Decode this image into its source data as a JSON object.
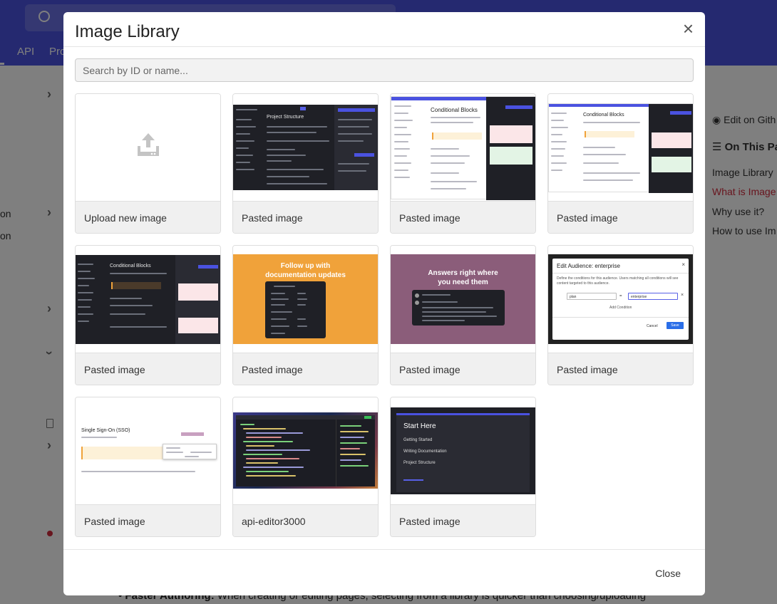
{
  "background": {
    "nav": [
      "API",
      "Pro"
    ],
    "sidebar_fragments": [
      "on",
      "on"
    ],
    "right_panel": {
      "edit_link": "Edit on Gith",
      "on_this_page": "On This Pag",
      "toc": [
        "Image Library",
        "What is Image",
        "Why use it?",
        "How to use Im"
      ]
    },
    "bottom_text_bold": "Faster Authoring:",
    "bottom_text": " When creating or editing pages, selecting from a library is quicker than choosing/uploading"
  },
  "modal": {
    "title": "Image Library",
    "close_icon": "×",
    "search_placeholder": "Search by ID or name...",
    "search_value": "",
    "cards": [
      {
        "label": "Upload new image",
        "thumb": "upload"
      },
      {
        "label": "Pasted image",
        "thumb": "dark-doc"
      },
      {
        "label": "Pasted image",
        "thumb": "light-doc"
      },
      {
        "label": "Pasted image",
        "thumb": "light-doc-2"
      },
      {
        "label": "Pasted image",
        "thumb": "dark-doc-2"
      },
      {
        "label": "Pasted image",
        "thumb": "orange-promo"
      },
      {
        "label": "Pasted image",
        "thumb": "purple-promo"
      },
      {
        "label": "Pasted image",
        "thumb": "edit-audience"
      },
      {
        "label": "Pasted image",
        "thumb": "sso"
      },
      {
        "label": "api-editor3000",
        "thumb": "code-editor"
      },
      {
        "label": "Pasted image",
        "thumb": "start-here"
      }
    ],
    "thumb_text": {
      "orange_promo": [
        "Follow up with",
        "documentation updates"
      ],
      "purple_promo": [
        "Answers right where",
        "you need them"
      ],
      "edit_audience": {
        "title": "Edit Audience: enterprise",
        "desc": "Define the conditions for this audience. Users matching all conditions will see content targeted to this audience.",
        "field_key": "plan",
        "operator": "=",
        "field_value": "enterprise",
        "add": "Add Condition",
        "cancel": "Cancel",
        "save": "Save"
      },
      "sso": {
        "title": "Single Sign-On (SSO)"
      },
      "start_here": {
        "title": "Start Here",
        "items": [
          "Getting Started",
          "Writing Documentation",
          "Project Structure"
        ]
      },
      "dark_doc": {
        "title": "Project Structure"
      },
      "light_doc": {
        "title": "Conditional Blocks"
      }
    },
    "footer_close": "Close"
  },
  "colors": {
    "brand": "#4a52e0",
    "accent_red": "#d12a3c",
    "orange": "#f0a23a",
    "purple": "#8b5d7a"
  }
}
